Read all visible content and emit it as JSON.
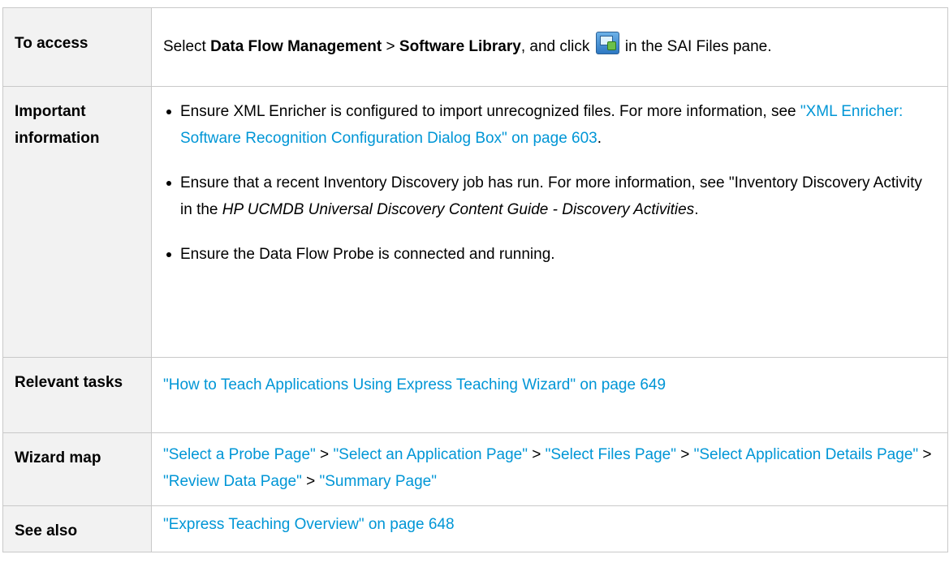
{
  "rows": {
    "access": {
      "label": "To access",
      "text1": "Select ",
      "bold1": "Data Flow Management",
      "sep": " > ",
      "bold2": "Software Library",
      "text2": ", and click ",
      "icon": "add-sai-file-icon",
      "text3": " in the SAI Files pane."
    },
    "important": {
      "label": "Important information",
      "b1_text": "Ensure XML Enricher is configured to import unrecognized files. For more information, see ",
      "b1_link": "\"XML Enricher: Software Recognition Configuration Dialog Box\" on page 603",
      "b1_end": ".",
      "b2_text": "Ensure that a recent Inventory Discovery job has run. For more information, see \"Inventory Discovery Activity in the ",
      "b2_italic": "HP UCMDB Universal Discovery Content Guide - Discovery Activities",
      "b2_end": ".",
      "b3_text": "Ensure the Data Flow Probe is connected and running."
    },
    "tasks": {
      "label": "Relevant tasks",
      "link": "\"How to Teach Applications Using Express Teaching Wizard\" on page 649"
    },
    "wizard": {
      "label": "Wizard map",
      "sep": " > ",
      "links": [
        "\"Select a Probe Page\"",
        "\"Select an Application Page\"",
        "\"Select Files Page\"",
        "\"Select Application Details Page\"",
        "\"Review Data Page\"",
        "\"Summary Page\""
      ]
    },
    "see_also": {
      "label": "See also",
      "link": "\"Express Teaching Overview\" on page 648"
    }
  },
  "colors": {
    "link": "#0096d6",
    "border": "#c9c9c9",
    "label_bg": "#f2f2f2"
  }
}
